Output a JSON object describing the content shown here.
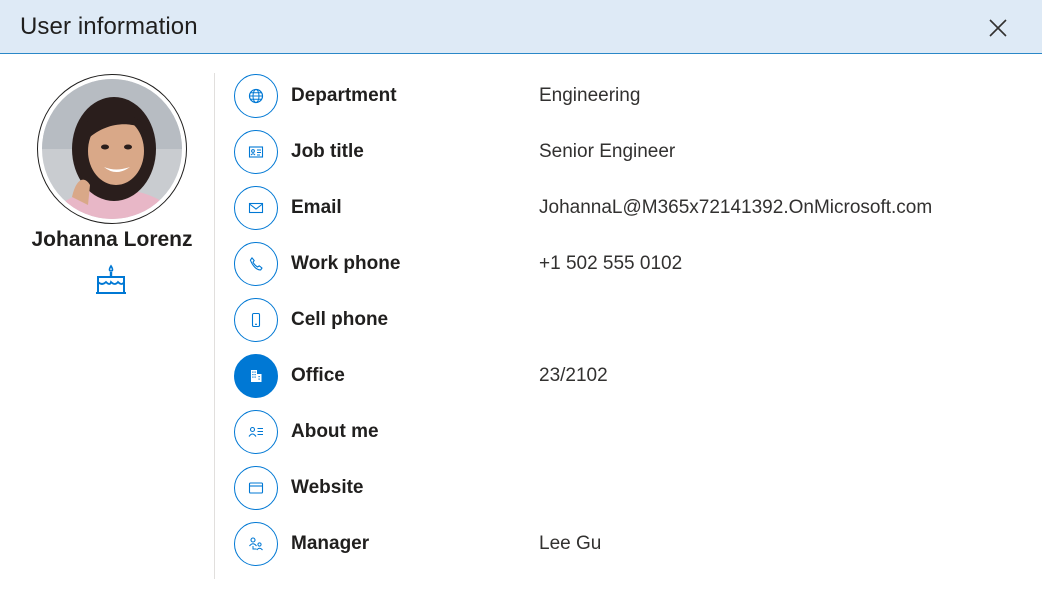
{
  "dialog": {
    "title": "User information",
    "close_icon": "close-icon"
  },
  "profile": {
    "name": "Johanna Lorenz",
    "avatar_icon": "avatar-photo",
    "birthday_icon": "birthday-cake-icon"
  },
  "colors": {
    "header_bg": "#deeaf6",
    "accent": "#0078d4",
    "text": "#201f1e"
  },
  "fields": [
    {
      "label": "Department",
      "value": "Engineering",
      "icon": "globe-icon"
    },
    {
      "label": "Job title",
      "value": "Senior Engineer",
      "icon": "id-card-icon"
    },
    {
      "label": "Email",
      "value": "JohannaL@M365x72141392.OnMicrosoft.com",
      "icon": "mail-icon"
    },
    {
      "label": "Work phone",
      "value": "+1 502 555 0102",
      "icon": "phone-icon"
    },
    {
      "label": "Cell phone",
      "value": "",
      "icon": "mobile-icon"
    },
    {
      "label": "Office",
      "value": "23/2102",
      "icon": "building-icon",
      "active": true
    },
    {
      "label": "About me",
      "value": "",
      "icon": "contact-list-icon"
    },
    {
      "label": "Website",
      "value": "",
      "icon": "browser-icon"
    },
    {
      "label": "Manager",
      "value": "Lee Gu",
      "icon": "org-icon"
    }
  ]
}
